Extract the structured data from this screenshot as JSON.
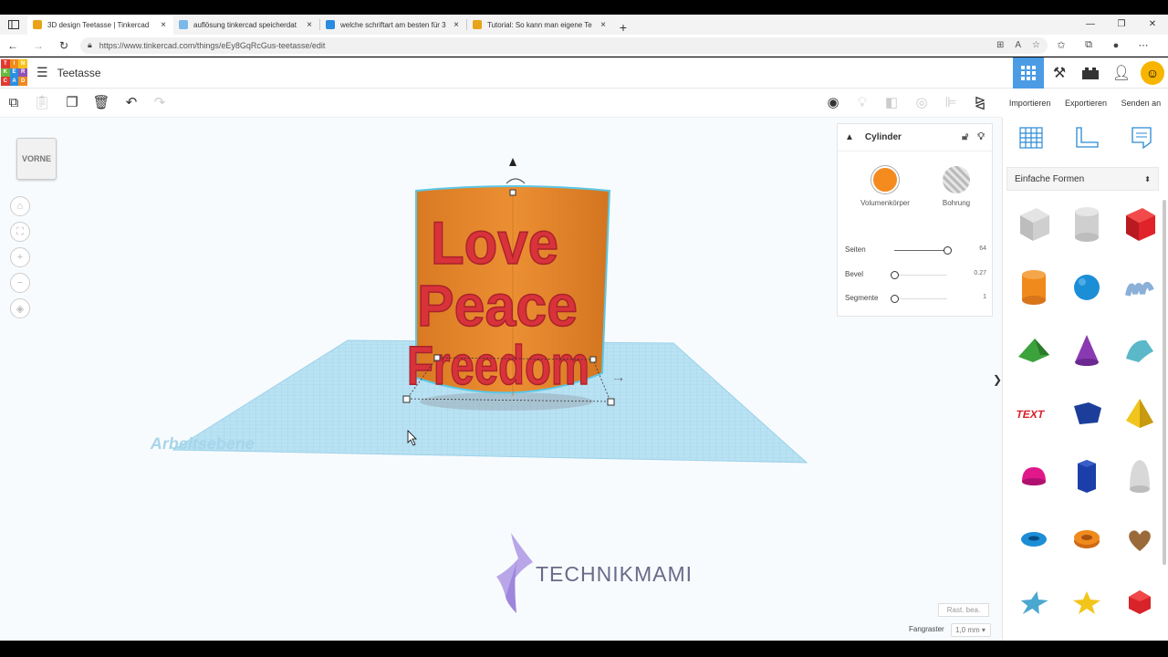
{
  "browser": {
    "tabs": [
      {
        "title": "3D design Teetasse | Tinkercad",
        "favicon_color": "#e8a318",
        "active": true
      },
      {
        "title": "auflösung tinkercad speicherdat",
        "favicon_color": "#7ab8e8",
        "active": false
      },
      {
        "title": "welche schriftart am besten für 3",
        "favicon_color": "#2b8be0",
        "active": false
      },
      {
        "title": "Tutorial: So kann man eigene Te",
        "favicon_color": "#e8a318",
        "active": false
      }
    ],
    "url": "https://www.tinkercad.com/things/eEy8GqRcGus-teetasse/edit"
  },
  "header": {
    "logo_letters": [
      "T",
      "I",
      "N",
      "K",
      "E",
      "R",
      "C",
      "A",
      "D"
    ],
    "logo_colors": [
      "#e03a2f",
      "#f08a1c",
      "#f7c21b",
      "#69b93c",
      "#2b8fe0",
      "#9251b6",
      "#e03a2f",
      "#2b8fe0",
      "#f08a1c"
    ],
    "project_title": "Teetasse"
  },
  "toolbar": {
    "import_label": "Importieren",
    "export_label": "Exportieren",
    "send_label": "Senden an"
  },
  "workspace": {
    "viewcube_label": "VORNE",
    "workplane_label": "Arbeitsebene",
    "watermark": "TECHNIKMAMI"
  },
  "model": {
    "text_lines": [
      "Love",
      "Peace",
      "Freedom"
    ],
    "cup_color": "#e98a2a",
    "text_color": "#d8323b"
  },
  "inspector": {
    "title": "Cylinder",
    "solid_label": "Volumenkörper",
    "hole_label": "Bohrung",
    "solid_color": "#f58a1f",
    "props": [
      {
        "label": "Seiten",
        "value": "64",
        "fraction": 1.0
      },
      {
        "label": "Bevel",
        "value": "0.27",
        "fraction": 0.0
      },
      {
        "label": "Segmente",
        "value": "1",
        "fraction": 0.0
      }
    ]
  },
  "snap": {
    "edit_grid": "Rast. bea.",
    "label": "Fangraster",
    "value": "1,0 mm ▾"
  },
  "shapes_panel": {
    "category": "Einfache Formen",
    "shapes": [
      {
        "name": "box-hole",
        "color": "#c8c8c8"
      },
      {
        "name": "cylinder-hole",
        "color": "#c8c8c8"
      },
      {
        "name": "box",
        "color": "#e0232a"
      },
      {
        "name": "cylinder",
        "color": "#f08a1c"
      },
      {
        "name": "sphere",
        "color": "#1c8ed6"
      },
      {
        "name": "scribble",
        "color": "#8ab0d8"
      },
      {
        "name": "roof",
        "color": "#3ca23c"
      },
      {
        "name": "cone",
        "color": "#8a3ab0"
      },
      {
        "name": "round-roof",
        "color": "#5ab8c8"
      },
      {
        "name": "text",
        "color": "#d8232a"
      },
      {
        "name": "polygon",
        "color": "#1c3e9a"
      },
      {
        "name": "pyramid",
        "color": "#f2c51c"
      },
      {
        "name": "half-sphere",
        "color": "#e0188a"
      },
      {
        "name": "hexagonal-prism",
        "color": "#1c3ea8"
      },
      {
        "name": "paraboloid",
        "color": "#d8d8d8"
      },
      {
        "name": "torus",
        "color": "#1c8ed6"
      },
      {
        "name": "tube",
        "color": "#f08a1c"
      },
      {
        "name": "heart",
        "color": "#9a6a3a"
      },
      {
        "name": "star",
        "color": "#4aa8d0"
      },
      {
        "name": "star-gold",
        "color": "#f2c51c"
      },
      {
        "name": "icosahedron",
        "color": "#d8232a"
      }
    ]
  }
}
